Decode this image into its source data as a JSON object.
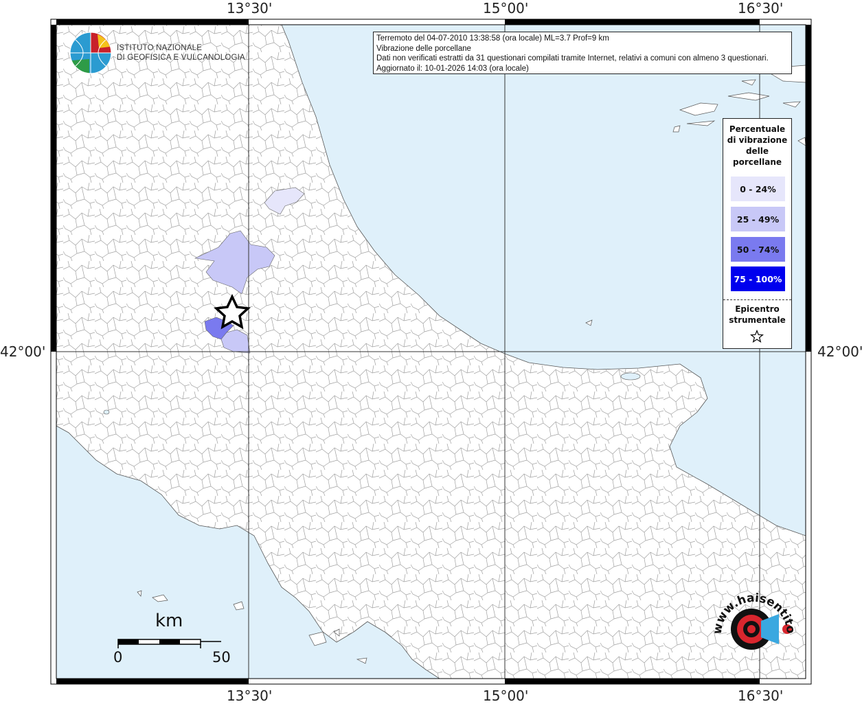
{
  "map": {
    "longitude_labels": [
      "13°30'",
      "15°00'",
      "16°30'"
    ],
    "latitude_labels": [
      "42°00'"
    ],
    "colors": {
      "sea": "#dff0fa",
      "land": "#ffffff",
      "boundary": "#8a8a8a",
      "grid": "#333333",
      "frame": "#000000"
    }
  },
  "logo": {
    "line1": "ISTITUTO NAZIONALE",
    "line2": "DI GEOFISICA E VULCANOLOGIA",
    "icon": "globe-icon"
  },
  "info": {
    "line1": "Terremoto del 04-07-2010 13:38:58 (ora locale) ML=3.7 Prof=9 km",
    "line2": "Vibrazione delle porcellane",
    "line3": "Dati non verificati estratti da 31 questionari compilati tramite Internet, relativi a comuni con almeno 3 questionari.",
    "line4": "Aggiornato il: 10-01-2026 14:03 (ora locale)"
  },
  "legend": {
    "title": "Percentuale\ndi vibrazione\ndelle\nporcellane",
    "classes": [
      {
        "label": "0 - 24%",
        "color": "#e6e6fb"
      },
      {
        "label": "25 - 49%",
        "color": "#c8c8f7"
      },
      {
        "label": "50 - 74%",
        "color": "#7a7aef"
      },
      {
        "label": "75 - 100%",
        "color": "#0000ee"
      }
    ],
    "epicenter_label": "Epicentro\nstrumentale",
    "epicenter_icon": "star-icon"
  },
  "scale": {
    "unit": "km",
    "min": "0",
    "max": "50"
  },
  "watermark": {
    "text": "www.haisentitoilterremoto.it",
    "icon": "megaphone-icon"
  }
}
